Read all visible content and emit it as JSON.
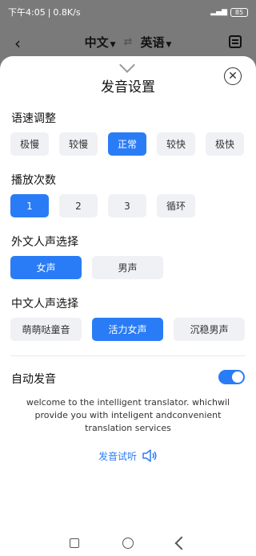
{
  "status": {
    "time": "下午4:05",
    "speed": "0.8K/s",
    "battery": "85"
  },
  "header": {
    "source_lang": "中文",
    "target_lang": "英语"
  },
  "sheet": {
    "title": "发音设置",
    "speed": {
      "label": "语速调整",
      "options": [
        "极慢",
        "较慢",
        "正常",
        "较快",
        "极快"
      ],
      "selected": "正常"
    },
    "repeat": {
      "label": "播放次数",
      "options": [
        "1",
        "2",
        "3",
        "循环"
      ],
      "selected": "1"
    },
    "foreign_voice": {
      "label": "外文人声选择",
      "options": [
        "女声",
        "男声"
      ],
      "selected": "女声"
    },
    "chinese_voice": {
      "label": "中文人声选择",
      "options": [
        "萌萌哒童音",
        "活力女声",
        "沉稳男声"
      ],
      "selected": "活力女声"
    },
    "auto": {
      "label": "自动发音",
      "enabled": true
    },
    "sample_text": "welcome to the intelligent translator. whichwil provide you with inteligent andconvenient translation services",
    "listen_label": "发音试听"
  }
}
